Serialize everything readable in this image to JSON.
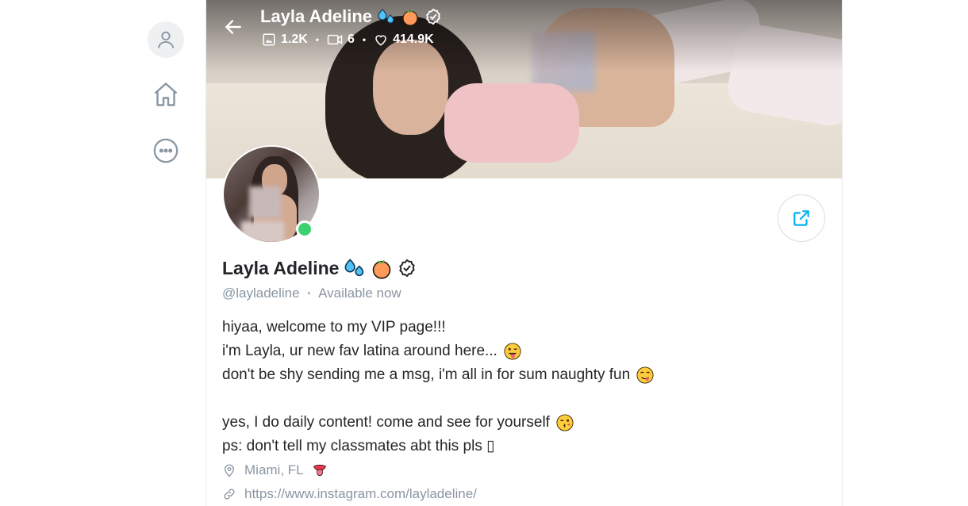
{
  "profile": {
    "name": "Layla Adeline",
    "handle": "@layladeline",
    "status": "Available now",
    "stats": {
      "photos": "1.2K",
      "videos": "6",
      "likes": "414.9K"
    },
    "bio": [
      "hiyaa, welcome to my VIP page!!!",
      "i'm Layla, ur new fav latina around here...",
      "don't be shy sending me a msg, i'm all in for sum naughty fun",
      "",
      "yes, I do daily content! come and see for yourself",
      "ps: don't tell my classmates abt this pls ▯"
    ],
    "location": "Miami, FL",
    "website": "https://www.instagram.com/layladeline/"
  },
  "colors": {
    "accent": "#00aff0",
    "muted": "#8a96a3",
    "online": "#3bd16f"
  },
  "icons": [
    "user-icon",
    "home-icon",
    "more-icon",
    "back-arrow-icon",
    "image-icon",
    "video-icon",
    "heart-icon",
    "share-icon",
    "location-pin-icon",
    "link-icon",
    "verified-icon",
    "sweat-droplets-emoji",
    "peach-emoji",
    "winking-tongue-emoji",
    "drooling-emoji",
    "kissing-wink-emoji",
    "tongue-emoji"
  ]
}
